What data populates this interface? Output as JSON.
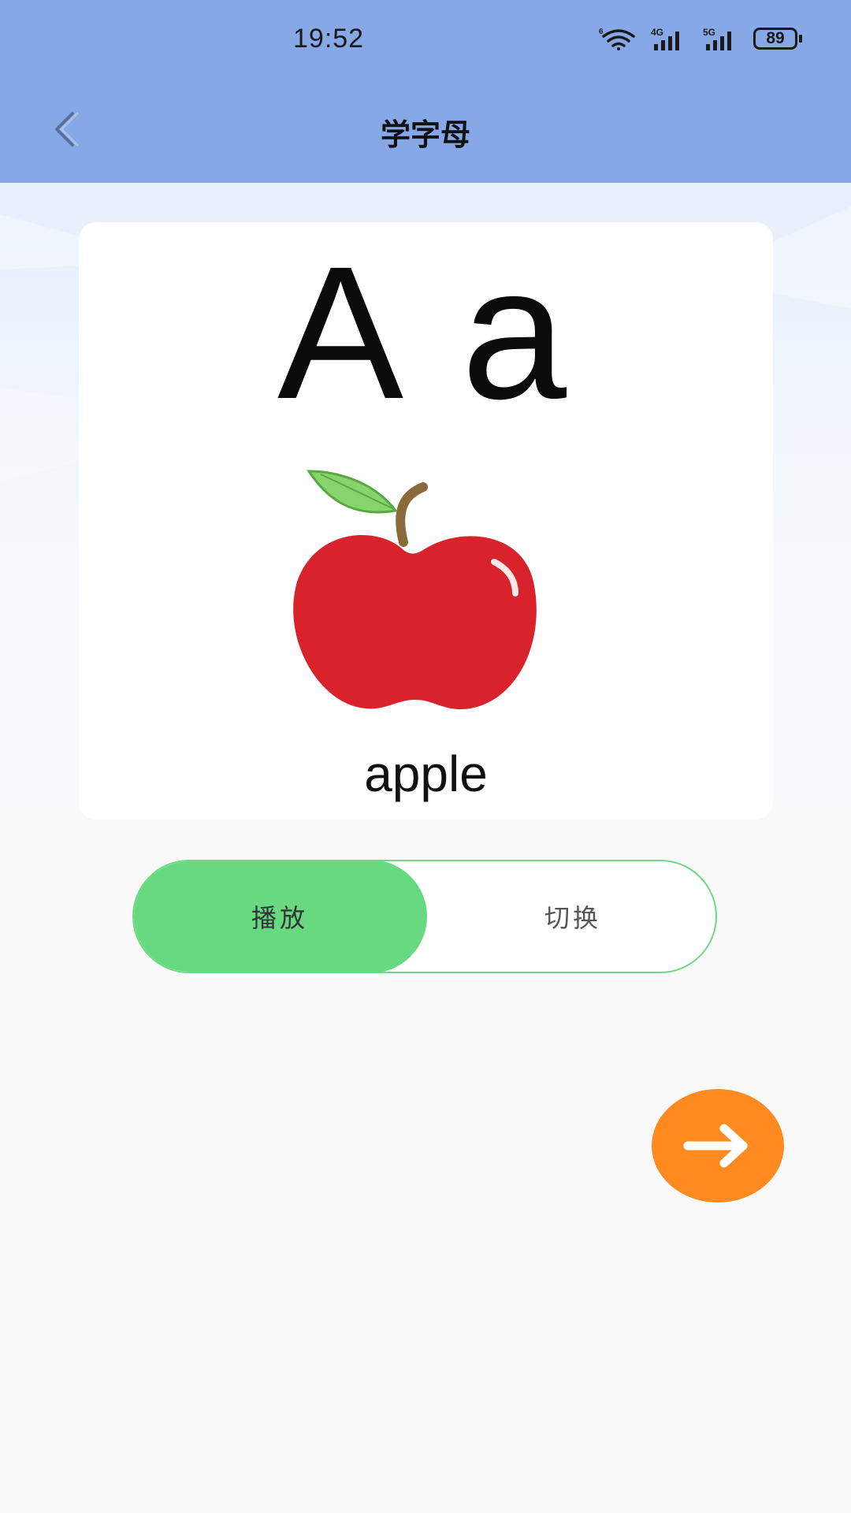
{
  "status_bar": {
    "time": "19:52",
    "wifi_label": "6",
    "signal_1_label": "4G",
    "signal_2_label": "5G",
    "battery": "89"
  },
  "header": {
    "title": "学字母"
  },
  "card": {
    "letters": "A a",
    "image_icon": "apple-icon",
    "word": "apple"
  },
  "controls": {
    "play_label": "播放",
    "switch_label": "切换",
    "active": "play",
    "next_icon": "arrow-right-icon"
  },
  "colors": {
    "header_bg": "#86a8e6",
    "toggle_active": "#66d981",
    "next_button": "#ff8a1f"
  }
}
